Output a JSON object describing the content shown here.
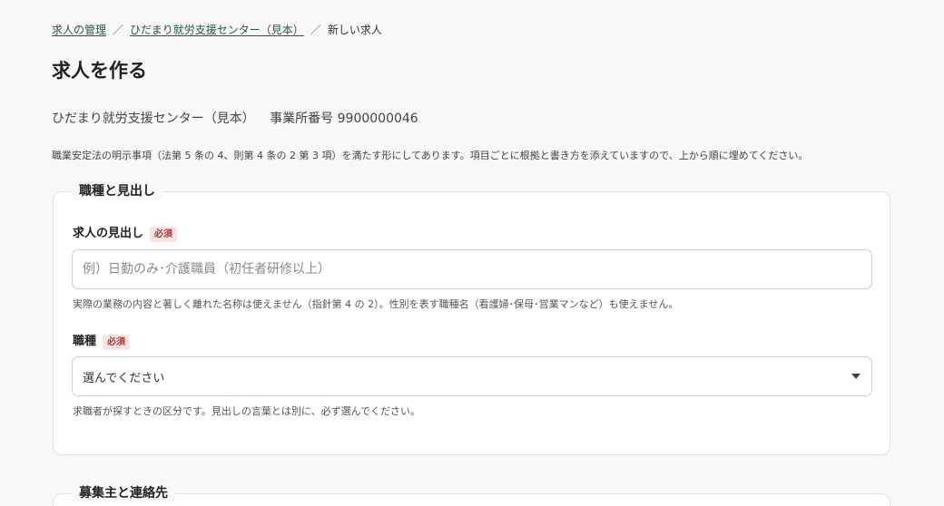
{
  "breadcrumb": {
    "items": [
      "求人の管理",
      "ひだまり就労支援センター（見本）"
    ],
    "separator": "／",
    "current": "新しい求人"
  },
  "page": {
    "title": "求人を作る",
    "office_name": "ひだまり就労支援センター（見本）",
    "office_number_label": "事業所番号",
    "office_number": "9900000046",
    "intro": "職業安定法の明示事項（法第 5 条の 4、則第 4 条の 2 第 3 項）を満たす形にしてあります。項目ごとに根拠と書き方を添えていますので、上から順に埋めてください。"
  },
  "section_job": {
    "legend": "職種と見出し",
    "headline": {
      "label": "求人の見出し",
      "required": "必須",
      "placeholder": "例）日勤のみ･介護職員（初任者研修以上）",
      "value": "",
      "hint": "実際の業務の内容と著しく離れた名称は使えません（指針第 4 の 2）。性別を表す職種名（看護婦･保母･営業マンなど）も使えません。"
    },
    "occupation": {
      "label": "職種",
      "required": "必須",
      "selected": "選んでください",
      "hint": "求職者が探すときの区分です。見出しの言葉とは別に、必ず選んでください。"
    }
  },
  "section_contact": {
    "legend": "募集主と連絡先"
  },
  "colors": {
    "background": "#f8f8f7",
    "link": "#1f5a3f",
    "required_bg": "#fbe4e4",
    "required_fg": "#a93737",
    "border": "#cfcfcb"
  }
}
